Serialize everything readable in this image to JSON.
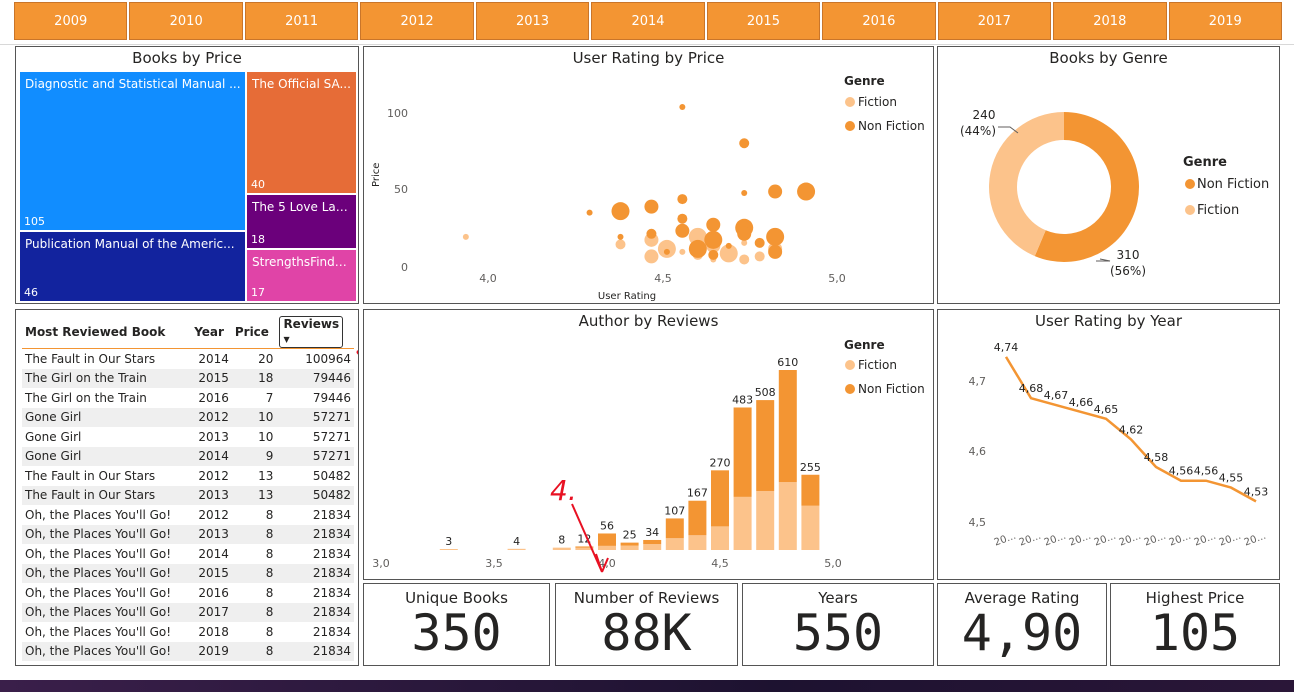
{
  "years": [
    "2009",
    "2010",
    "2011",
    "2012",
    "2013",
    "2014",
    "2015",
    "2016",
    "2017",
    "2018",
    "2019"
  ],
  "books_by_price": {
    "title": "Books by Price",
    "cells": [
      {
        "name": "Diagnostic and Statistical Manual ...",
        "value": "105",
        "color": "#118dff"
      },
      {
        "name": "Publication Manual of the Americ...",
        "value": "46",
        "color": "#12239e"
      },
      {
        "name": "The Official SA...",
        "value": "40",
        "color": "#e66c37"
      },
      {
        "name": "The 5 Love Lan...",
        "value": "18",
        "color": "#6b007b"
      },
      {
        "name": "StrengthsFinde...",
        "value": "17",
        "color": "#e044a7"
      }
    ]
  },
  "user_rating_by_price": {
    "title": "User Rating by Price",
    "legend_title": "Genre",
    "legend": [
      "Fiction",
      "Non Fiction"
    ],
    "colors": {
      "Fiction": "#fcc38b",
      "Non Fiction": "#f39533"
    },
    "ylabel": "Price",
    "xlabel": "User Rating",
    "xticks": [
      "4,0",
      "4,5",
      "5,0"
    ],
    "yticks": [
      "100",
      "50",
      "0"
    ]
  },
  "books_by_genre": {
    "title": "Books by Genre",
    "legend_title": "Genre",
    "legend": [
      "Non Fiction",
      "Fiction"
    ],
    "labels": [
      {
        "value": "240",
        "pct": "(44%)"
      },
      {
        "value": "310",
        "pct": "(56%)"
      }
    ]
  },
  "most_reviewed": {
    "headers": [
      "Most Reviewed Book",
      "Year",
      "Price",
      "Reviews"
    ],
    "rows": [
      [
        "The Fault in Our Stars",
        "2014",
        "20",
        "100964"
      ],
      [
        "The Girl on the Train",
        "2015",
        "18",
        "79446"
      ],
      [
        "The Girl on the Train",
        "2016",
        "7",
        "79446"
      ],
      [
        "Gone Girl",
        "2012",
        "10",
        "57271"
      ],
      [
        "Gone Girl",
        "2013",
        "10",
        "57271"
      ],
      [
        "Gone Girl",
        "2014",
        "9",
        "57271"
      ],
      [
        "The Fault in Our Stars",
        "2012",
        "13",
        "50482"
      ],
      [
        "The Fault in Our Stars",
        "2013",
        "13",
        "50482"
      ],
      [
        "Oh, the Places You'll Go!",
        "2012",
        "8",
        "21834"
      ],
      [
        "Oh, the Places You'll Go!",
        "2013",
        "8",
        "21834"
      ],
      [
        "Oh, the Places You'll Go!",
        "2014",
        "8",
        "21834"
      ],
      [
        "Oh, the Places You'll Go!",
        "2015",
        "8",
        "21834"
      ],
      [
        "Oh, the Places You'll Go!",
        "2016",
        "8",
        "21834"
      ],
      [
        "Oh, the Places You'll Go!",
        "2017",
        "8",
        "21834"
      ],
      [
        "Oh, the Places You'll Go!",
        "2018",
        "8",
        "21834"
      ],
      [
        "Oh, the Places You'll Go!",
        "2019",
        "8",
        "21834"
      ]
    ]
  },
  "annotations": [
    "4.",
    "4."
  ],
  "author_by_reviews": {
    "title": "Author by Reviews",
    "legend_title": "Genre",
    "legend": [
      "Fiction",
      "Non Fiction"
    ],
    "xticks": [
      "3,0",
      "3,5",
      "4,0",
      "4,5",
      "5,0"
    ]
  },
  "user_rating_by_year": {
    "title": "User Rating by Year",
    "yticks": [
      "4,7",
      "4,6",
      "4,5"
    ],
    "xtick": "20..."
  },
  "cards": [
    {
      "label": "Unique Books",
      "value": "350"
    },
    {
      "label": "Number of Reviews",
      "value": "88K"
    },
    {
      "label": "Years",
      "value": "550"
    },
    {
      "label": "Average Rating",
      "value": "4,90"
    },
    {
      "label": "Highest Price",
      "value": "105"
    }
  ],
  "chart_data": [
    {
      "type": "scatter",
      "title": "User Rating by Price",
      "xlabel": "User Rating",
      "ylabel": "Price",
      "xlim": [
        3.6,
        5.0
      ],
      "ylim": [
        0,
        110
      ],
      "series": [
        {
          "name": "Fiction",
          "points": [
            [
              3.8,
              20
            ],
            [
              4.3,
              15
            ],
            [
              4.4,
              18
            ],
            [
              4.45,
              12
            ],
            [
              4.5,
              10
            ],
            [
              4.55,
              8
            ],
            [
              4.6,
              14
            ],
            [
              4.65,
              9
            ],
            [
              4.7,
              16
            ],
            [
              4.75,
              7
            ],
            [
              4.8,
              12
            ],
            [
              4.55,
              20
            ],
            [
              4.6,
              5
            ],
            [
              4.7,
              5
            ],
            [
              4.4,
              7
            ]
          ]
        },
        {
          "name": "Non Fiction",
          "points": [
            [
              4.5,
              106
            ],
            [
              4.7,
              82
            ],
            [
              4.8,
              50
            ],
            [
              4.9,
              50
            ],
            [
              4.7,
              49
            ],
            [
              4.5,
              45
            ],
            [
              4.4,
              40
            ],
            [
              4.3,
              37
            ],
            [
              4.2,
              36
            ],
            [
              4.5,
              32
            ],
            [
              4.6,
              28
            ],
            [
              4.7,
              26
            ],
            [
              4.3,
              20
            ],
            [
              4.4,
              22
            ],
            [
              4.5,
              24
            ],
            [
              4.6,
              18
            ],
            [
              4.65,
              14
            ],
            [
              4.75,
              16
            ],
            [
              4.8,
              10
            ],
            [
              4.55,
              12
            ],
            [
              4.45,
              10
            ],
            [
              4.6,
              8
            ],
            [
              4.7,
              22
            ],
            [
              4.8,
              20
            ]
          ]
        }
      ]
    },
    {
      "type": "pie",
      "title": "Books by Genre",
      "categories": [
        "Non Fiction",
        "Fiction"
      ],
      "values": [
        310,
        240
      ],
      "colors": [
        "#f39533",
        "#fcc38b"
      ]
    },
    {
      "type": "bar",
      "title": "Author by Reviews",
      "x": [
        3.3,
        3.6,
        3.8,
        3.9,
        4.0,
        4.1,
        4.2,
        4.3,
        4.4,
        4.5,
        4.6,
        4.7,
        4.8,
        4.9
      ],
      "totals": [
        "3",
        "4",
        "8",
        "12",
        "56",
        "25",
        "34",
        "107",
        "167",
        "270",
        "483",
        "508",
        "610",
        "255"
      ],
      "series": [
        {
          "name": "Fiction",
          "values": [
            3,
            4,
            8,
            8,
            14,
            15,
            20,
            40,
            50,
            80,
            180,
            200,
            230,
            150
          ]
        },
        {
          "name": "Non Fiction",
          "values": [
            0,
            0,
            0,
            4,
            42,
            10,
            14,
            67,
            117,
            190,
            303,
            308,
            380,
            105
          ]
        }
      ],
      "xlim": [
        3.0,
        5.0
      ]
    },
    {
      "type": "line",
      "title": "User Rating by Year",
      "x": [
        "2009",
        "2010",
        "2011",
        "2012",
        "2013",
        "2014",
        "2015",
        "2016",
        "2017",
        "2018",
        "2019"
      ],
      "values": [
        4.74,
        4.68,
        4.67,
        4.66,
        4.65,
        4.62,
        4.58,
        4.56,
        4.56,
        4.55,
        4.53
      ],
      "labels": [
        "4,74",
        "4,68",
        "4,67",
        "4,66",
        "4,65",
        "4,62",
        "4,58",
        "4,56",
        "4,56",
        "4,55",
        "4,53"
      ],
      "ylim": [
        4.5,
        4.75
      ]
    }
  ]
}
